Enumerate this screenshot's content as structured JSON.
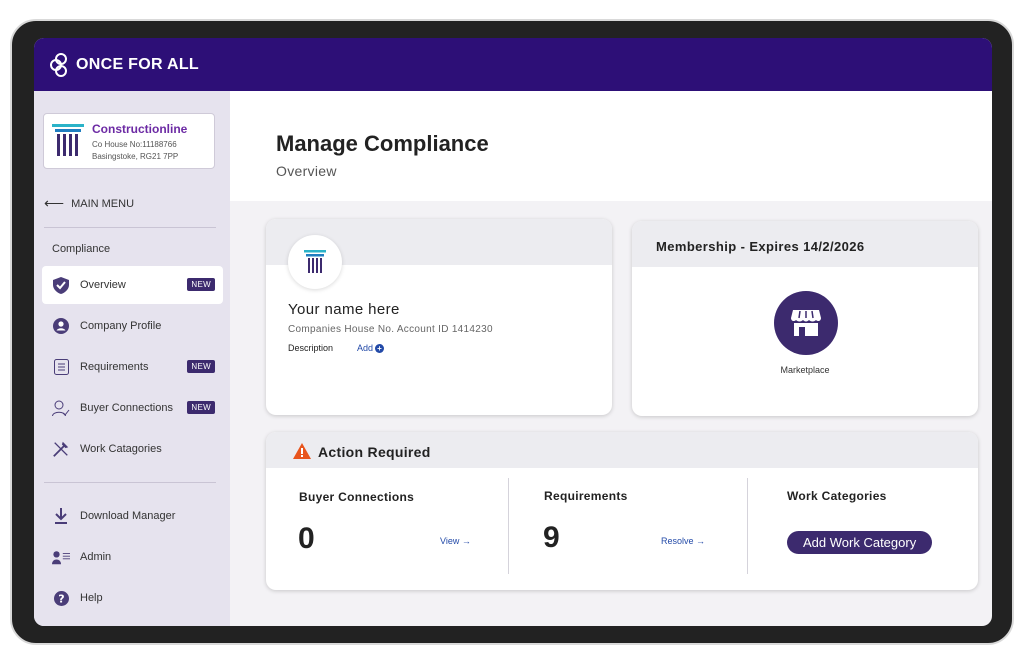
{
  "app": {
    "brand": "ONCE FOR ALL"
  },
  "org": {
    "name": "Constructionline",
    "co_house": "Co House No:11188766",
    "address": "Basingstoke, RG21 7PP"
  },
  "sidebar": {
    "main_menu": "MAIN MENU",
    "section": "Compliance",
    "items": [
      {
        "label": "Overview",
        "badge": "NEW",
        "icon": "shield-check-icon"
      },
      {
        "label": "Company Profile",
        "icon": "user-circle-icon"
      },
      {
        "label": "Requirements",
        "badge": "NEW",
        "icon": "list-icon"
      },
      {
        "label": "Buyer Connections",
        "badge": "NEW",
        "icon": "user-check-icon"
      },
      {
        "label": "Work Catagories",
        "icon": "tools-icon"
      }
    ],
    "bottom_items": [
      {
        "label": "Download Manager",
        "icon": "download-icon"
      },
      {
        "label": "Admin",
        "icon": "admin-icon"
      },
      {
        "label": "Help",
        "icon": "help-icon"
      }
    ]
  },
  "page": {
    "title": "Manage Compliance",
    "subtitle": "Overview"
  },
  "profile": {
    "name": "Your name here",
    "companies_house": "Companies House No. Account ID 1414230",
    "description_label": "Description",
    "add_label": "Add"
  },
  "membership": {
    "title": "Membership - Expires 14/2/2026",
    "marketplace_label": "Marketplace"
  },
  "action": {
    "title": "Action Required",
    "buyer_connections": {
      "title": "Buyer Connections",
      "count": "0",
      "link": "View →"
    },
    "requirements": {
      "title": "Requirements",
      "count": "9",
      "link": "Resolve →"
    },
    "work_categories": {
      "title": "Work Categories",
      "button": "Add Work Category"
    }
  },
  "colors": {
    "brand": "#2d0f77",
    "accent": "#3c2a6e",
    "link": "#234aa8",
    "warning": "#e8541c"
  }
}
